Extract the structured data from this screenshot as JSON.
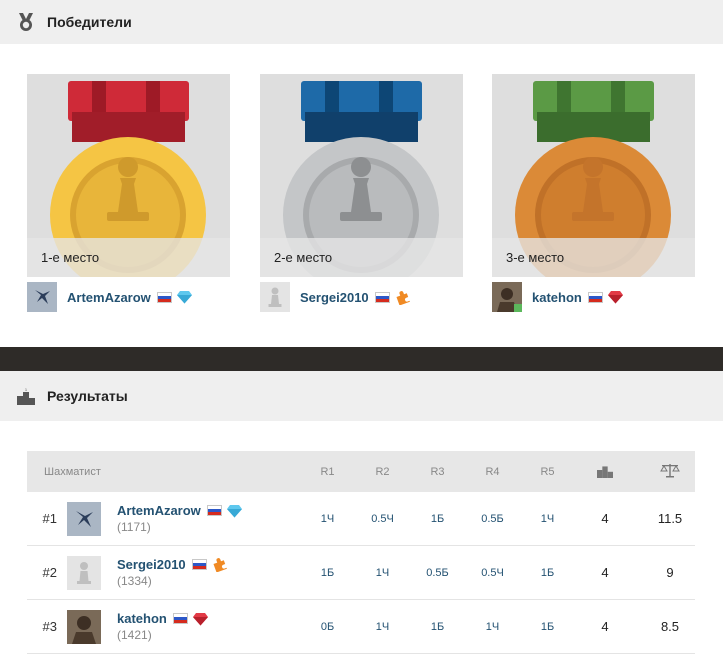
{
  "winners_section": {
    "title": "Победители",
    "icon": "medal-icon"
  },
  "medals": [
    {
      "place_label": "1-е место",
      "player": "ArtemAzarow",
      "flag": "russia-flag-icon",
      "badge": "diamond-icon",
      "ribbon_color": "#cf2a38",
      "ribbon_dark": "#9e1a26",
      "medal_color": "#f5c544",
      "medal_inner": "#e8b53a",
      "medal_ring": "#d9a330",
      "piece_color": "#cf9a2c"
    },
    {
      "place_label": "2-е место",
      "player": "Sergei2010",
      "flag": "russia-flag-icon",
      "badge": "puzzle-icon",
      "ribbon_color": "#1e6aa8",
      "ribbon_dark": "#0d4675",
      "medal_color": "#c4c6c8",
      "medal_inner": "#b9bbbd",
      "medal_ring": "#a8aaac",
      "piece_color": "#8d8f91"
    },
    {
      "place_label": "3-е место",
      "player": "katehon",
      "flag": "russia-flag-icon",
      "badge": "ruby-icon",
      "ribbon_color": "#5b9a45",
      "ribbon_dark": "#3f7530",
      "medal_color": "#db8a37",
      "medal_inner": "#cf7e2e",
      "medal_ring": "#c07128",
      "piece_color": "#c4742b"
    }
  ],
  "results_section": {
    "title": "Результаты",
    "icon": "podium-icon"
  },
  "table": {
    "headers": {
      "player": "Шахматист",
      "rounds": [
        "R1",
        "R2",
        "R3",
        "R4",
        "R5"
      ],
      "points_icon": "podium-icon",
      "tiebreak_icon": "scales-icon"
    },
    "rows": [
      {
        "rank": "#1",
        "name": "ArtemAzarow",
        "rating": "(1171)",
        "badge": "diamond-icon",
        "rounds": [
          "1Ч",
          "0.5Ч",
          "1Б",
          "0.5Б",
          "1Ч"
        ],
        "points": "4",
        "tiebreak": "11.5"
      },
      {
        "rank": "#2",
        "name": "Sergei2010",
        "rating": "(1334)",
        "badge": "puzzle-icon",
        "rounds": [
          "1Б",
          "1Ч",
          "0.5Б",
          "0.5Ч",
          "1Б"
        ],
        "points": "4",
        "tiebreak": "9"
      },
      {
        "rank": "#3",
        "name": "katehon",
        "rating": "(1421)",
        "badge": "ruby-icon",
        "rounds": [
          "0Б",
          "1Ч",
          "1Б",
          "1Ч",
          "1Б"
        ],
        "points": "4",
        "tiebreak": "8.5"
      }
    ]
  }
}
